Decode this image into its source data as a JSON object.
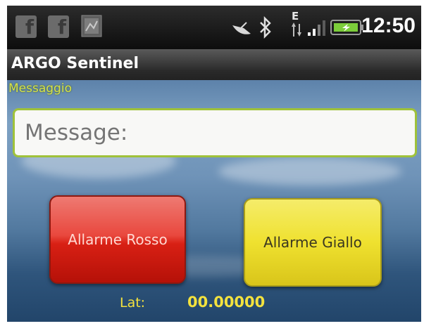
{
  "status_bar": {
    "icons": [
      "facebook-icon",
      "facebook-icon",
      "gallery-icon",
      "satellite-dish-icon",
      "bluetooth-icon",
      "edge-network-icon",
      "signal-icon",
      "battery-icon"
    ],
    "network_letter": "E",
    "time": "12:50"
  },
  "app": {
    "title": "ARGO Sentinel"
  },
  "message": {
    "section_label": "Messaggio",
    "placeholder": "Message:",
    "value": ""
  },
  "buttons": {
    "red_label": "Allarme Rosso",
    "yellow_label": "Allarme Giallo"
  },
  "location": {
    "lat_label": "Lat:",
    "lat_value": "00.00000"
  },
  "colors": {
    "red_button": "#e33a2e",
    "yellow_button": "#efe12f",
    "label_text": "#f3e23e",
    "input_border": "#9fc23a"
  }
}
